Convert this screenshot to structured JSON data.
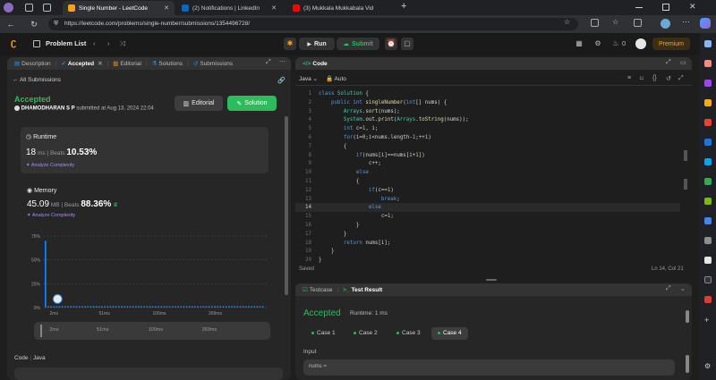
{
  "browser": {
    "tabs": [
      {
        "title": "Single Number - LeetCode",
        "active": true,
        "color": "#f89f1b"
      },
      {
        "title": "(2) Notifications | LinkedIn",
        "active": false,
        "color": "#0a66c2"
      },
      {
        "title": "(3) Mukkala Mukkabala Vid",
        "active": false,
        "color": "#ff0000"
      }
    ],
    "new_tab": "+",
    "url": "https://leetcode.com/problems/single-number/submissions/1354496728/"
  },
  "nav": {
    "problem_list": "Problem List",
    "run": "Run",
    "submit": "Submit",
    "streak": "0",
    "premium": "Premium"
  },
  "left": {
    "tabs": {
      "description": "Description",
      "accepted": "Accepted",
      "editorial": "Editorial",
      "solutions": "Solutions",
      "submissions": "Submissions"
    },
    "all_submissions": "All Submissions",
    "status": "Accepted",
    "user": "DHAMODHARAN S P",
    "submitted_at": "submitted at Aug 13, 2024 22:04",
    "editorial_btn": "Editorial",
    "solution_btn": "Solution",
    "runtime": {
      "label": "Runtime",
      "value": "18",
      "unit": "ms",
      "beats_label": "Beats",
      "beats": "10.53%",
      "analyze": "Analyze Complexity"
    },
    "memory": {
      "label": "Memory",
      "value": "45.09",
      "unit": "MB",
      "beats_label": "Beats",
      "beats": "88.36%",
      "analyze": "Analyze Complexity"
    },
    "code_label": "Code",
    "lang_label": "Java"
  },
  "chart_data": {
    "type": "bar",
    "categories": [
      "2ms",
      "51ms",
      "100ms",
      "269ms"
    ],
    "yticks": [
      "75%",
      "50%",
      "25%",
      "0%"
    ],
    "ylim": [
      0,
      75
    ],
    "values": [
      70,
      1.5,
      1.5,
      1.5,
      1.5,
      1.5,
      1.5,
      1.5,
      1.5,
      1.5,
      1.5,
      1.5,
      1.5,
      1.5,
      1.5,
      1.5,
      1.5,
      1.5,
      1.5,
      1.5,
      1.5,
      1.5,
      1.5,
      1.5,
      1.5,
      1.5,
      1.5,
      1.5,
      1.5,
      1.5,
      1.5,
      1.5,
      1.5,
      1.5,
      1.5,
      1.5,
      1.5,
      1.5,
      1.5,
      1.5,
      1.5,
      1.5,
      1.5,
      1.5,
      1.5,
      1.5,
      1.5,
      1.5,
      1.5,
      1.5,
      1.5,
      1.5,
      1.5,
      1.5,
      1.5,
      1.5,
      1.5,
      1.5,
      1.5,
      1.5,
      1.5,
      1.5,
      1.5,
      1.5,
      1.5,
      1.5,
      1.5,
      1.5,
      1.5,
      1.5,
      1.5,
      1.5,
      1.5,
      1.5,
      1.5,
      1.5,
      1.5,
      1.5
    ],
    "bar_color": "#0a84ff",
    "highlight_index": 2,
    "xlabel": "",
    "ylabel": ""
  },
  "code_panel": {
    "title": "Code",
    "lang": "Java",
    "mode": "Auto",
    "saved": "Saved",
    "cursor": "Ln 14, Col 21",
    "active_line": 14,
    "lines": [
      "class Solution {",
      "    public int singleNumber(int[] nums) {",
      "        Arrays.sort(nums);",
      "        System.out.print(Arrays.toString(nums));",
      "        int c=1, i;",
      "        for(i=0;i<nums.length-1;++i)",
      "        {",
      "            if(nums[i]==nums[i+1])",
      "                c++;",
      "            else",
      "            {",
      "                if(c==1)",
      "                    break;",
      "                else",
      "                    c=1;",
      "            }",
      "        }",
      "        return nums[i];",
      "    }",
      "}"
    ]
  },
  "result_panel": {
    "tab_testcase": "Testcase",
    "tab_result": "Test Result",
    "status": "Accepted",
    "runtime": "Runtime: 1 ms",
    "cases": [
      "Case 1",
      "Case 2",
      "Case 3",
      "Case 4"
    ],
    "active_case": 3,
    "input_label": "Input",
    "input_first": "nums ="
  },
  "colors": {
    "accent_green": "#2cbb5d",
    "premium": "#ffa116",
    "bar_blue": "#0a84ff"
  }
}
